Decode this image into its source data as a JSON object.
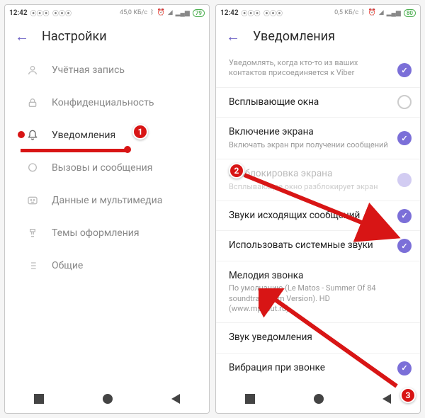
{
  "status": {
    "time": "12:42",
    "net": "45,0 КБ/с",
    "net2": "0,5 КБ/с",
    "battery": "79",
    "battery2": "80"
  },
  "left": {
    "title": "Настройки",
    "items": [
      {
        "label": "Учётная запись"
      },
      {
        "label": "Конфиденциальность"
      },
      {
        "label": "Уведомления"
      },
      {
        "label": "Вызовы и сообщения"
      },
      {
        "label": "Данные и мультимедиа"
      },
      {
        "label": "Темы оформления"
      },
      {
        "label": "Общие"
      }
    ]
  },
  "right": {
    "title": "Уведомления",
    "items": [
      {
        "title": "",
        "sub": "Уведомлять, когда кто-то из ваших контактов присоединяется к Viber"
      },
      {
        "title": "Всплывающие окна"
      },
      {
        "title": "Включение экрана",
        "sub": "Включать экран при получении сообщений"
      },
      {
        "title": "Разблокировка экрана",
        "sub": "Всплывающее окно разблокирует экран"
      },
      {
        "title": "Звуки исходящих сообщений"
      },
      {
        "title": "Использовать системные звуки"
      },
      {
        "title": "Мелодия звонка",
        "sub": "По умолчанию (Le Matos - Summer Of 84 soundtrack Film Version). HD (www.mp3cut.ru)"
      },
      {
        "title": "Звук уведомления"
      },
      {
        "title": "Вибрация при звонке"
      }
    ]
  },
  "annot": {
    "n1": "1",
    "n2": "2",
    "n3": "3"
  }
}
